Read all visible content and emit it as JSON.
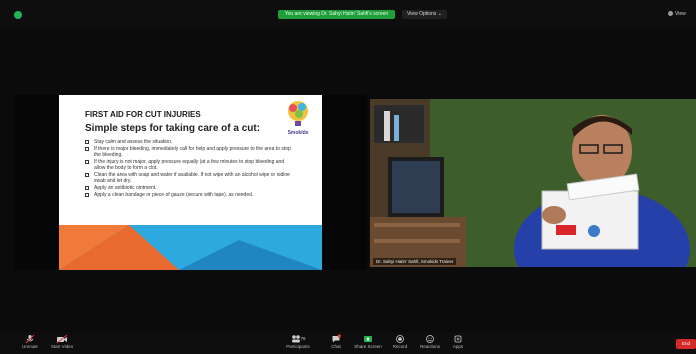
{
  "topbar": {
    "share_banner": "You are viewing Dr. Sahyi Hatin' Sahfi's screen",
    "view_options": "View Options ⌄",
    "view_button": "View"
  },
  "slide": {
    "title": "FIRST AID FOR CUT INJURIES",
    "heading": "Simple steps for taking care of a cut:",
    "bullets": [
      "Stay calm and assess the situation.",
      "If there is major bleeding, immediately call for help and apply pressure to the area to stop the bleeding.",
      "If the injury is not major, apply pressure equally (at a few minutes to stop bleeding and allow the body to form a clot.",
      "Clean the area with soap and water if available. If not wipe with an alcohol wipe or iodine swab and let dry.",
      "Apply an antibiotic ointment.",
      "Apply a clean bandage or piece of gauze (secure with tape), as needed."
    ],
    "logo_text": "Smokids"
  },
  "webcam": {
    "name_label": "Dr. Sahyi Hatin' Sahfi, Smokids Trainer"
  },
  "toolbar": {
    "items": [
      {
        "label": "Unmute",
        "icon": "microphone-icon"
      },
      {
        "label": "Start Video",
        "icon": "video-camera-icon"
      },
      {
        "label": "Participants",
        "count": "76",
        "icon": "participants-icon"
      },
      {
        "label": "Chat",
        "icon": "chat-icon"
      },
      {
        "label": "Share Screen",
        "icon": "share-screen-icon"
      },
      {
        "label": "Record",
        "icon": "record-icon"
      },
      {
        "label": "Reactions",
        "icon": "reactions-icon"
      },
      {
        "label": "Apps",
        "icon": "apps-icon"
      }
    ],
    "end_label": "End"
  },
  "colors": {
    "background": "#0b0b0b",
    "share_green": "#1f9e3a",
    "end_red": "#d42a2a",
    "slide_blue": "#2ea9e0",
    "slide_orange": "#f07a3a"
  }
}
